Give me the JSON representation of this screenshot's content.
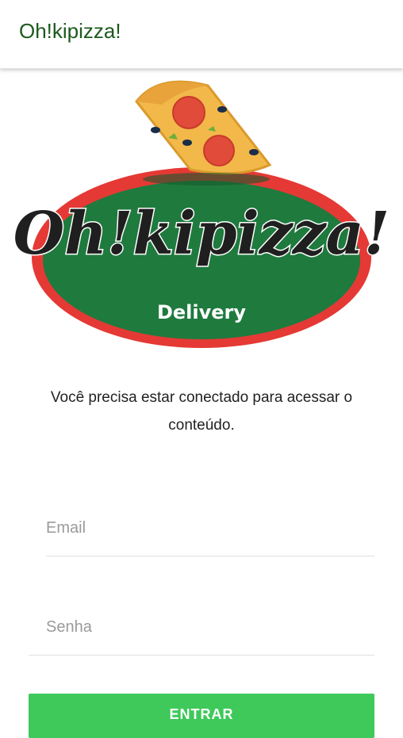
{
  "appbar": {
    "title": "Oh!kipizza!"
  },
  "logo": {
    "brand_text": "Oh!kipizza!",
    "subtitle": "Delivery"
  },
  "message": "Você precisa estar conectado para acessar o conteúdo.",
  "form": {
    "email_placeholder": "Email",
    "password_placeholder": "Senha",
    "submit_label": "ENTRAR"
  },
  "colors": {
    "accent": "#3ec95a",
    "title": "#1c5a1c",
    "logo_red": "#e53935",
    "logo_green": "#1f7a3e"
  }
}
